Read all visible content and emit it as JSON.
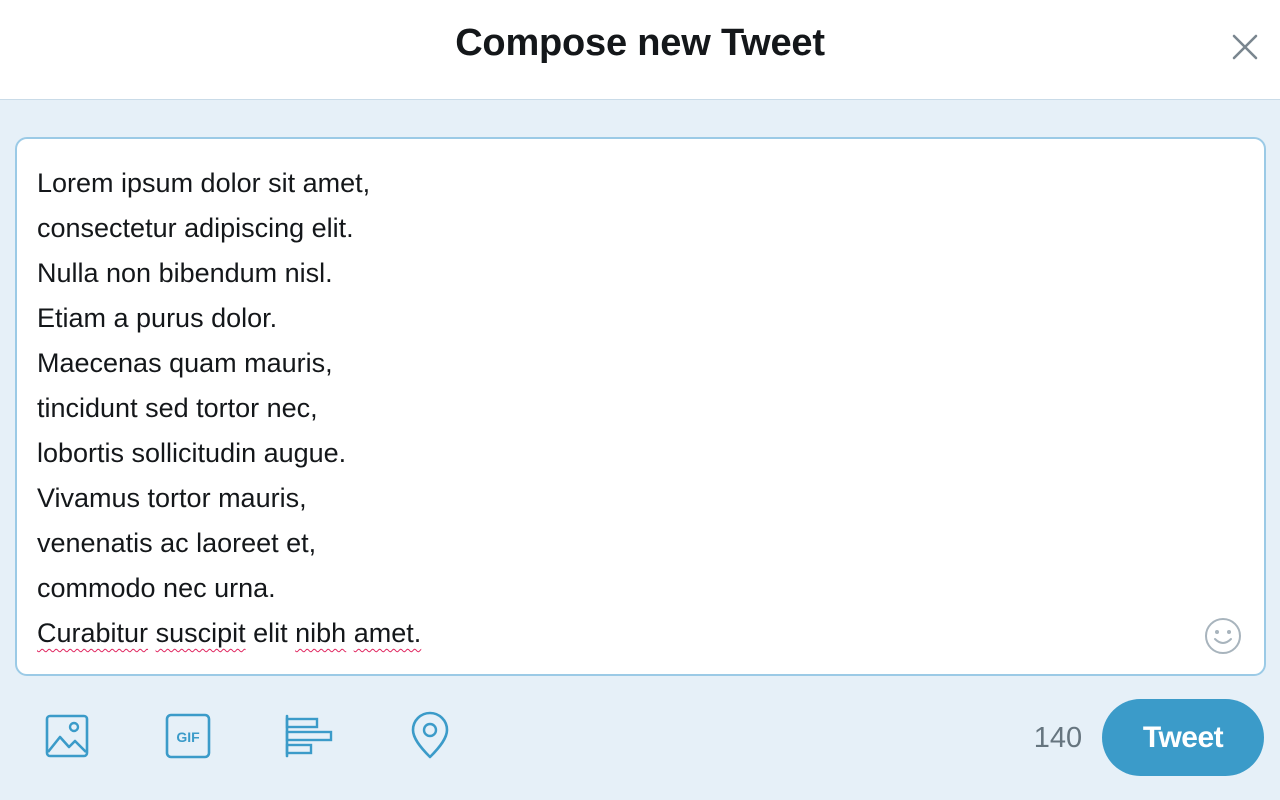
{
  "header": {
    "title": "Compose new Tweet",
    "close_icon": "close-icon"
  },
  "compose": {
    "lines": [
      "Lorem ipsum dolor sit amet,",
      "consectetur adipiscing elit.",
      "Nulla non bibendum nisl.",
      "Etiam a purus dolor.",
      "Maecenas quam mauris,",
      "tincidunt sed tortor nec,",
      "lobortis sollicitudin augue.",
      "Vivamus tortor mauris,",
      "venenatis ac laoreet et,",
      "commodo nec urna."
    ],
    "last_line_words": [
      "Curabitur",
      "suscipit",
      "elit",
      "nibh",
      "amet."
    ],
    "emoji_icon": "smiley-face-icon"
  },
  "toolbar": {
    "icons": [
      "image-icon",
      "gif-icon",
      "poll-icon",
      "location-pin-icon"
    ],
    "gif_label": "GIF",
    "char_count": "140",
    "tweet_label": "Tweet"
  },
  "colors": {
    "accent": "#3b9bc9",
    "background": "#e6f0f8",
    "border": "#9bcae6",
    "spell_error": "#e0245e"
  }
}
